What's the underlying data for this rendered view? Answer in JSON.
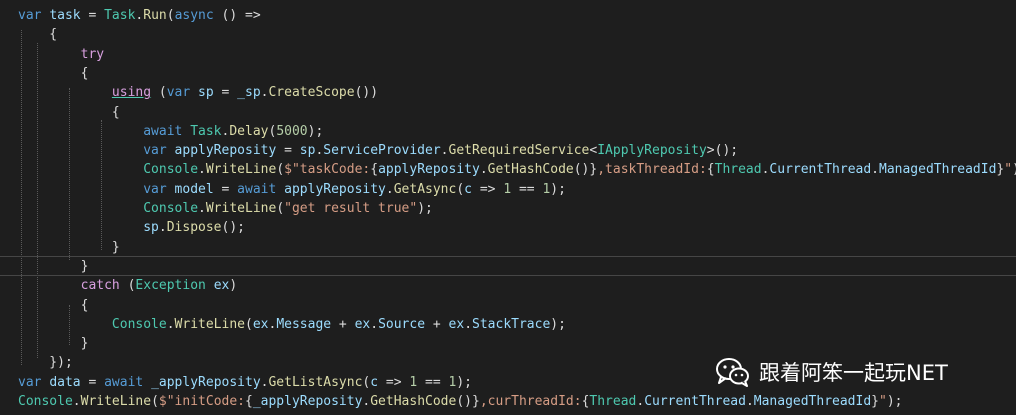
{
  "colors": {
    "background": "#1e1e1e",
    "keyword": "#569cd6",
    "control": "#d8a0df",
    "type": "#4ec9b0",
    "method": "#dcdcaa",
    "variable": "#9cdcfe",
    "string": "#d69d85",
    "number": "#b5cea8",
    "text": "#dcdcdc",
    "watermark_text": "#ffffff"
  },
  "code_lines": [
    [
      {
        "t": "var",
        "c": "keyword"
      },
      {
        "t": " "
      },
      {
        "t": "task",
        "c": "variable"
      },
      {
        "t": " = "
      },
      {
        "t": "Task",
        "c": "type"
      },
      {
        "t": "."
      },
      {
        "t": "Run",
        "c": "method"
      },
      {
        "t": "("
      },
      {
        "t": "async",
        "c": "keyword"
      },
      {
        "t": " () =>"
      }
    ],
    [
      {
        "t": "    {"
      }
    ],
    [
      {
        "t": "        "
      },
      {
        "t": "try",
        "c": "control"
      }
    ],
    [
      {
        "t": "        {"
      }
    ],
    [
      {
        "t": "            "
      },
      {
        "t": "using",
        "c": "control"
      },
      {
        "t": " ("
      },
      {
        "t": "var",
        "c": "keyword"
      },
      {
        "t": " "
      },
      {
        "t": "sp",
        "c": "variable"
      },
      {
        "t": " = "
      },
      {
        "t": "_sp",
        "c": "variable"
      },
      {
        "t": "."
      },
      {
        "t": "CreateScope",
        "c": "method"
      },
      {
        "t": "())"
      }
    ],
    [
      {
        "t": "            {"
      }
    ],
    [
      {
        "t": "                "
      },
      {
        "t": "await",
        "c": "keyword"
      },
      {
        "t": " "
      },
      {
        "t": "Task",
        "c": "type"
      },
      {
        "t": "."
      },
      {
        "t": "Delay",
        "c": "method"
      },
      {
        "t": "("
      },
      {
        "t": "5000",
        "c": "number"
      },
      {
        "t": ");"
      }
    ],
    [
      {
        "t": "                "
      },
      {
        "t": "var",
        "c": "keyword"
      },
      {
        "t": " "
      },
      {
        "t": "applyReposity",
        "c": "variable"
      },
      {
        "t": " = "
      },
      {
        "t": "sp",
        "c": "variable"
      },
      {
        "t": "."
      },
      {
        "t": "ServiceProvider",
        "c": "variable"
      },
      {
        "t": "."
      },
      {
        "t": "GetRequiredService",
        "c": "method"
      },
      {
        "t": "<"
      },
      {
        "t": "IApplyReposity",
        "c": "type"
      },
      {
        "t": ">();"
      }
    ],
    [
      {
        "t": "                "
      },
      {
        "t": "Console",
        "c": "type"
      },
      {
        "t": "."
      },
      {
        "t": "WriteLine",
        "c": "method"
      },
      {
        "t": "("
      },
      {
        "t": "$\"taskCode:",
        "c": "string"
      },
      {
        "t": "{"
      },
      {
        "t": "applyReposity",
        "c": "variable"
      },
      {
        "t": "."
      },
      {
        "t": "GetHashCode",
        "c": "method"
      },
      {
        "t": "()}"
      },
      {
        "t": ",taskThreadId:",
        "c": "string"
      },
      {
        "t": "{"
      },
      {
        "t": "Thread",
        "c": "type"
      },
      {
        "t": "."
      },
      {
        "t": "CurrentThread",
        "c": "variable"
      },
      {
        "t": "."
      },
      {
        "t": "ManagedThreadId",
        "c": "variable"
      },
      {
        "t": "}"
      },
      {
        "t": "\"",
        "c": "string"
      },
      {
        "t": ");"
      }
    ],
    [
      {
        "t": "                "
      },
      {
        "t": "var",
        "c": "keyword"
      },
      {
        "t": " "
      },
      {
        "t": "model",
        "c": "variable"
      },
      {
        "t": " = "
      },
      {
        "t": "await",
        "c": "keyword"
      },
      {
        "t": " "
      },
      {
        "t": "applyReposity",
        "c": "variable"
      },
      {
        "t": "."
      },
      {
        "t": "GetAsync",
        "c": "method"
      },
      {
        "t": "("
      },
      {
        "t": "c",
        "c": "variable"
      },
      {
        "t": " => "
      },
      {
        "t": "1",
        "c": "number"
      },
      {
        "t": " == "
      },
      {
        "t": "1",
        "c": "number"
      },
      {
        "t": ");"
      }
    ],
    [
      {
        "t": "                "
      },
      {
        "t": "Console",
        "c": "type"
      },
      {
        "t": "."
      },
      {
        "t": "WriteLine",
        "c": "method"
      },
      {
        "t": "("
      },
      {
        "t": "\"get result true\"",
        "c": "string"
      },
      {
        "t": ");"
      }
    ],
    [
      {
        "t": "                "
      },
      {
        "t": "sp",
        "c": "variable"
      },
      {
        "t": "."
      },
      {
        "t": "Dispose",
        "c": "method"
      },
      {
        "t": "();"
      }
    ],
    [
      {
        "t": "            }"
      }
    ],
    [
      {
        "t": "        }"
      }
    ],
    [
      {
        "t": "        "
      },
      {
        "t": "catch",
        "c": "control"
      },
      {
        "t": " ("
      },
      {
        "t": "Exception",
        "c": "type"
      },
      {
        "t": " "
      },
      {
        "t": "ex",
        "c": "variable"
      },
      {
        "t": ")"
      }
    ],
    [
      {
        "t": "        {"
      }
    ],
    [
      {
        "t": "            "
      },
      {
        "t": "Console",
        "c": "type"
      },
      {
        "t": "."
      },
      {
        "t": "WriteLine",
        "c": "method"
      },
      {
        "t": "("
      },
      {
        "t": "ex",
        "c": "variable"
      },
      {
        "t": "."
      },
      {
        "t": "Message",
        "c": "variable"
      },
      {
        "t": " + "
      },
      {
        "t": "ex",
        "c": "variable"
      },
      {
        "t": "."
      },
      {
        "t": "Source",
        "c": "variable"
      },
      {
        "t": " + "
      },
      {
        "t": "ex",
        "c": "variable"
      },
      {
        "t": "."
      },
      {
        "t": "StackTrace",
        "c": "variable"
      },
      {
        "t": ");"
      }
    ],
    [
      {
        "t": "        }"
      }
    ],
    [
      {
        "t": "    });"
      }
    ],
    [
      {
        "t": "var",
        "c": "keyword"
      },
      {
        "t": " "
      },
      {
        "t": "data",
        "c": "variable"
      },
      {
        "t": " = "
      },
      {
        "t": "await",
        "c": "keyword"
      },
      {
        "t": " "
      },
      {
        "t": "_applyReposity",
        "c": "variable"
      },
      {
        "t": "."
      },
      {
        "t": "GetListAsync",
        "c": "method"
      },
      {
        "t": "("
      },
      {
        "t": "c",
        "c": "variable"
      },
      {
        "t": " => "
      },
      {
        "t": "1",
        "c": "number"
      },
      {
        "t": " == "
      },
      {
        "t": "1",
        "c": "number"
      },
      {
        "t": ");"
      }
    ],
    [
      {
        "t": "Console",
        "c": "type"
      },
      {
        "t": "."
      },
      {
        "t": "WriteLine",
        "c": "method"
      },
      {
        "t": "("
      },
      {
        "t": "$\"initCode:",
        "c": "string"
      },
      {
        "t": "{"
      },
      {
        "t": "_applyReposity",
        "c": "variable"
      },
      {
        "t": "."
      },
      {
        "t": "GetHashCode",
        "c": "method"
      },
      {
        "t": "()}"
      },
      {
        "t": ",curThreadId:",
        "c": "string"
      },
      {
        "t": "{"
      },
      {
        "t": "Thread",
        "c": "type"
      },
      {
        "t": "."
      },
      {
        "t": "CurrentThread",
        "c": "variable"
      },
      {
        "t": "."
      },
      {
        "t": "ManagedThreadId",
        "c": "variable"
      },
      {
        "t": "}"
      },
      {
        "t": "\"",
        "c": "string"
      },
      {
        "t": ");"
      }
    ]
  ],
  "watermark": {
    "icon": "wechat-icon",
    "text": "跟着阿笨一起玩NET"
  }
}
